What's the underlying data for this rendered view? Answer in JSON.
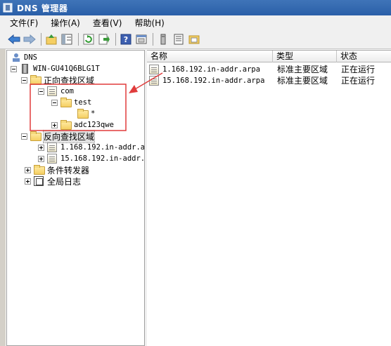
{
  "window": {
    "title": "DNS 管理器"
  },
  "menu": [
    "文件(F)",
    "操作(A)",
    "查看(V)",
    "帮助(H)"
  ],
  "toolbar": [
    "back-icon",
    "forward-icon",
    "up-folder-icon",
    "show-tree-icon",
    "refresh-icon",
    "export-icon",
    "help-icon",
    "properties-icon",
    "server-icon",
    "list-icon",
    "zone-icon"
  ],
  "tree": {
    "root": "DNS",
    "server": "WIN-GU41Q6BLG1T",
    "forward_zones": "正向查找区域",
    "com": "com",
    "test": "test",
    "wildcard": "*",
    "adc": "adc123qwe",
    "reverse_zones": "反向查找区域",
    "rev1": "1.168.192.in-addr.a",
    "rev2": "15.168.192.in-addr.",
    "forwarders": "条件转发器",
    "global_logs": "全局日志"
  },
  "list": {
    "columns": [
      "名称",
      "类型",
      "状态"
    ],
    "rows": [
      {
        "name": "1.168.192.in-addr.arpa",
        "type": "标准主要区域",
        "status": "正在运行"
      },
      {
        "name": "15.168.192.in-addr.arpa",
        "type": "标准主要区域",
        "status": "正在运行"
      }
    ]
  },
  "colors": {
    "title_bar": "#2a5fa8",
    "annotation": "#e03c3c"
  }
}
